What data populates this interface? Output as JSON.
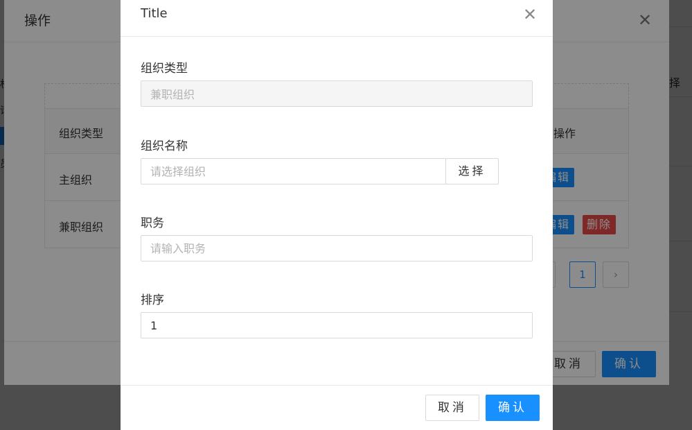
{
  "background_page": {
    "left_fragments": [
      "权",
      "请",
      "员"
    ],
    "right_fragment": "择",
    "accent": "#1890ff"
  },
  "middle_dialog": {
    "title": "操作",
    "close_icon": "close-icon",
    "table": {
      "columns": [
        "组织类型",
        "操作"
      ],
      "rows": [
        {
          "type": "主组织",
          "actions": [
            "编辑"
          ]
        },
        {
          "type": "兼职组织",
          "actions": [
            "编辑",
            "删除"
          ]
        }
      ]
    },
    "pagination": {
      "current_page": "1",
      "prev_icon": "chevron-left-icon",
      "next_icon": "chevron-right-icon"
    },
    "footer": {
      "cancel": "取消",
      "confirm": "确认"
    }
  },
  "front_dialog": {
    "title": "Title",
    "close_icon": "close-icon",
    "fields": {
      "org_type": {
        "label": "组织类型",
        "value": "兼职组织"
      },
      "org_name": {
        "label": "组织名称",
        "placeholder": "请选择组织",
        "select_button": "选择"
      },
      "position": {
        "label": "职务",
        "placeholder": "请输入职务"
      },
      "sort": {
        "label": "排序",
        "value": "1"
      }
    },
    "footer": {
      "cancel": "取消",
      "confirm": "确认"
    }
  },
  "colors": {
    "primary": "#1890ff",
    "danger": "#e84a4a",
    "mask": "rgba(0,0,0,0.45)"
  }
}
